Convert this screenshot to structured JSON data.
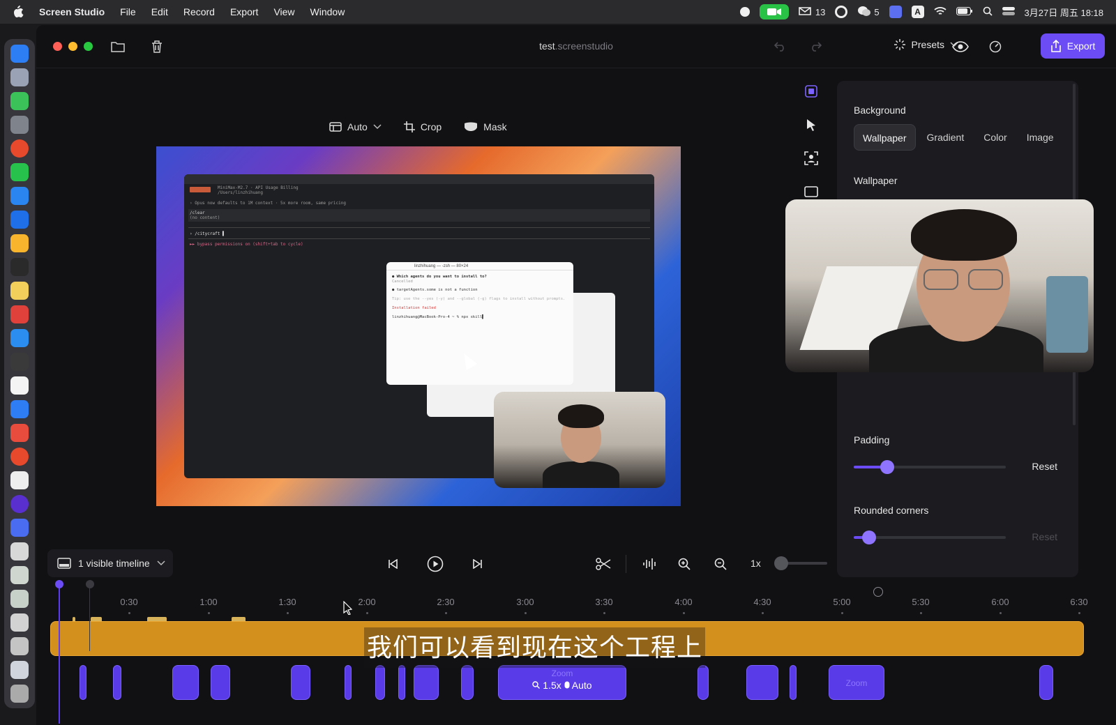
{
  "menubar": {
    "app_name": "Screen Studio",
    "items": [
      "File",
      "Edit",
      "Record",
      "Export",
      "View",
      "Window"
    ],
    "tray": {
      "mail_count": "13",
      "wechat_count": "5",
      "input_label": "A",
      "datetime": "3月27日 周五 18:18"
    }
  },
  "window": {
    "title_name": "test",
    "title_ext": ".screenstudio",
    "presets_label": "Presets",
    "export_label": "Export"
  },
  "canvas_tools": {
    "layout_label": "Auto",
    "crop_label": "Crop",
    "mask_label": "Mask"
  },
  "preview": {
    "term_lines": [
      "MiniMax-M2.7 · API Usage Billing",
      "/Users/linzhihuang",
      "› Opus now defaults to 1M context · 5x more room, same pricing",
      "/clear",
      "  (no content)",
      "› /citycraft ▌",
      "  ►► bypass permissions on (shift+tab to cycle)"
    ],
    "popup_title": "linzhihuang — -zsh — 80×24",
    "popup_lines": [
      "● Which agents do you want to install to?",
      "  Cancelled",
      "● targetAgents.some is not a function",
      "  Tip: use the --yes (-y) and --global (-g) flags to install without prompts.",
      "  Installation failed",
      "linzhihuang@MacBook-Pro-4 ~ % npx skill▌"
    ]
  },
  "panel": {
    "background_heading": "Background",
    "bg_options": [
      "Wallpaper",
      "Gradient",
      "Color",
      "Image"
    ],
    "bg_active": "Wallpaper",
    "wallpaper_heading": "Wallpaper",
    "padding_heading": "Padding",
    "padding_value": 0.22,
    "padding_reset": "Reset",
    "corners_heading": "Rounded corners",
    "corners_value": 0.1,
    "corners_reset": "Reset"
  },
  "controls": {
    "visible_timeline_label": "1 visible timeline",
    "speed_label": "1x"
  },
  "timeline": {
    "ticks": [
      "0:30",
      "1:00",
      "1:30",
      "2:00",
      "2:30",
      "3:00",
      "3:30",
      "4:00",
      "4:30",
      "5:00",
      "5:30",
      "6:00",
      "6:30"
    ],
    "subtitle": "我们可以看到现在这个工程上",
    "zoom_label": "Zoom",
    "zoom_value": "1.5x",
    "zoom_mode": "Auto",
    "zoom_faint_label": "Zoom"
  },
  "colors": {
    "accent": "#6b4cf5",
    "clip": "#d4901c",
    "zoom_block": "#5a3be8"
  }
}
